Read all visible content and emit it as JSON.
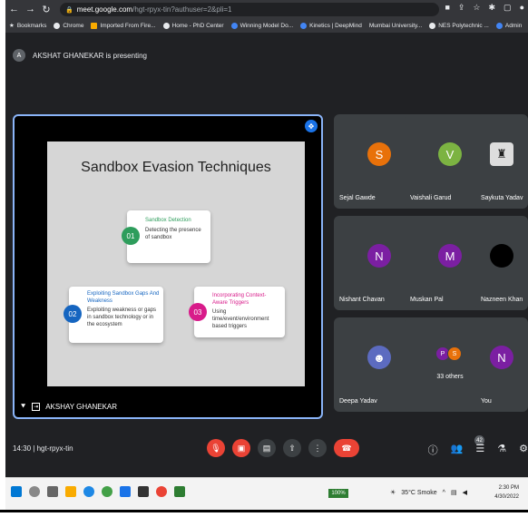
{
  "browser": {
    "url_host": "meet.google.com",
    "url_path": "/hgt-rpyx-tin?authuser=2&pli=1",
    "bookmarks": [
      "Bookmarks",
      "Chrome",
      "Imported From Fire...",
      "Home - PhD Center",
      "Winning Model Do...",
      "Kinetics | DeepMind",
      "Mumbai University...",
      "NES Polytechnic ...",
      "Admin"
    ]
  },
  "meet": {
    "presenter_banner": "AKSHAT GHANEKAR is presenting",
    "presenter_initial": "A",
    "presenting_tile_name": "AKSHAY GHANEKAR",
    "slide": {
      "title": "Sandbox Evasion Techniques",
      "items": [
        {
          "num": "01",
          "title": "Sandbox Detection",
          "body": "Detecting the presence of sandbox"
        },
        {
          "num": "02",
          "title": "Exploiting Sandbox Gaps And Weakness",
          "body": "Exploiting weakness or gaps in sandbox technology or in the ecosystem"
        },
        {
          "num": "03",
          "title": "Incorporating Context-Aware Triggers",
          "body": "Using time/event/environment based triggers"
        }
      ]
    },
    "participants": [
      {
        "initial": "S",
        "name": "Sejal Gawde",
        "color": "#e8710a"
      },
      {
        "initial": "V",
        "name": "Vaishali Garud",
        "color": "#7cb342"
      },
      {
        "initial": "",
        "name": "Saykuta Yadav",
        "color": "#5f6368"
      },
      {
        "initial": "N",
        "name": "Nishant Chavan",
        "color": "#7b1fa2"
      },
      {
        "initial": "M",
        "name": "Muskan Pal",
        "color": "#7b1fa2"
      },
      {
        "initial": "",
        "name": "Nazneen Khan",
        "color": "#000000"
      },
      {
        "initial": "",
        "name": "Deepa Yadav",
        "color": "#5c6bc0"
      },
      {
        "initial": "",
        "name": "33 others",
        "color": "#3c4043"
      },
      {
        "initial": "N",
        "name": "You",
        "color": "#7b1fa2"
      }
    ],
    "others_avatars": [
      "P",
      "S"
    ],
    "meeting_time": "14:30",
    "meeting_code": "hgt-rpyx-tin",
    "participants_badge": "42"
  },
  "taskbar": {
    "battery": "100%",
    "weather": "35°C Smoke",
    "time": "2:30 PM",
    "date": "4/30/2022"
  },
  "colors": {
    "presenting_border": "#8ab4f8",
    "mic_off": "#ea4335",
    "hangup": "#ea4335",
    "num01": "#2e9d5c",
    "num02": "#1565c0",
    "num03": "#d81b8a"
  }
}
